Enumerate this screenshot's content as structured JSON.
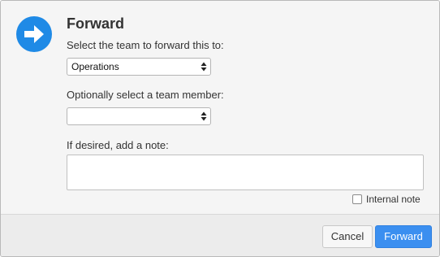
{
  "dialog": {
    "title": "Forward",
    "icon": "arrow-right-circle-icon",
    "accent_color": "#1f8ae6"
  },
  "team": {
    "label": "Select the team to forward this to:",
    "selected": "Operations"
  },
  "member": {
    "label": "Optionally select a team member:",
    "selected": ""
  },
  "note": {
    "label": "If desired, add a note:",
    "value": "",
    "internal_label": "Internal note",
    "internal_checked": false
  },
  "footer": {
    "cancel_label": "Cancel",
    "forward_label": "Forward",
    "primary_color": "#3b8ff0"
  }
}
